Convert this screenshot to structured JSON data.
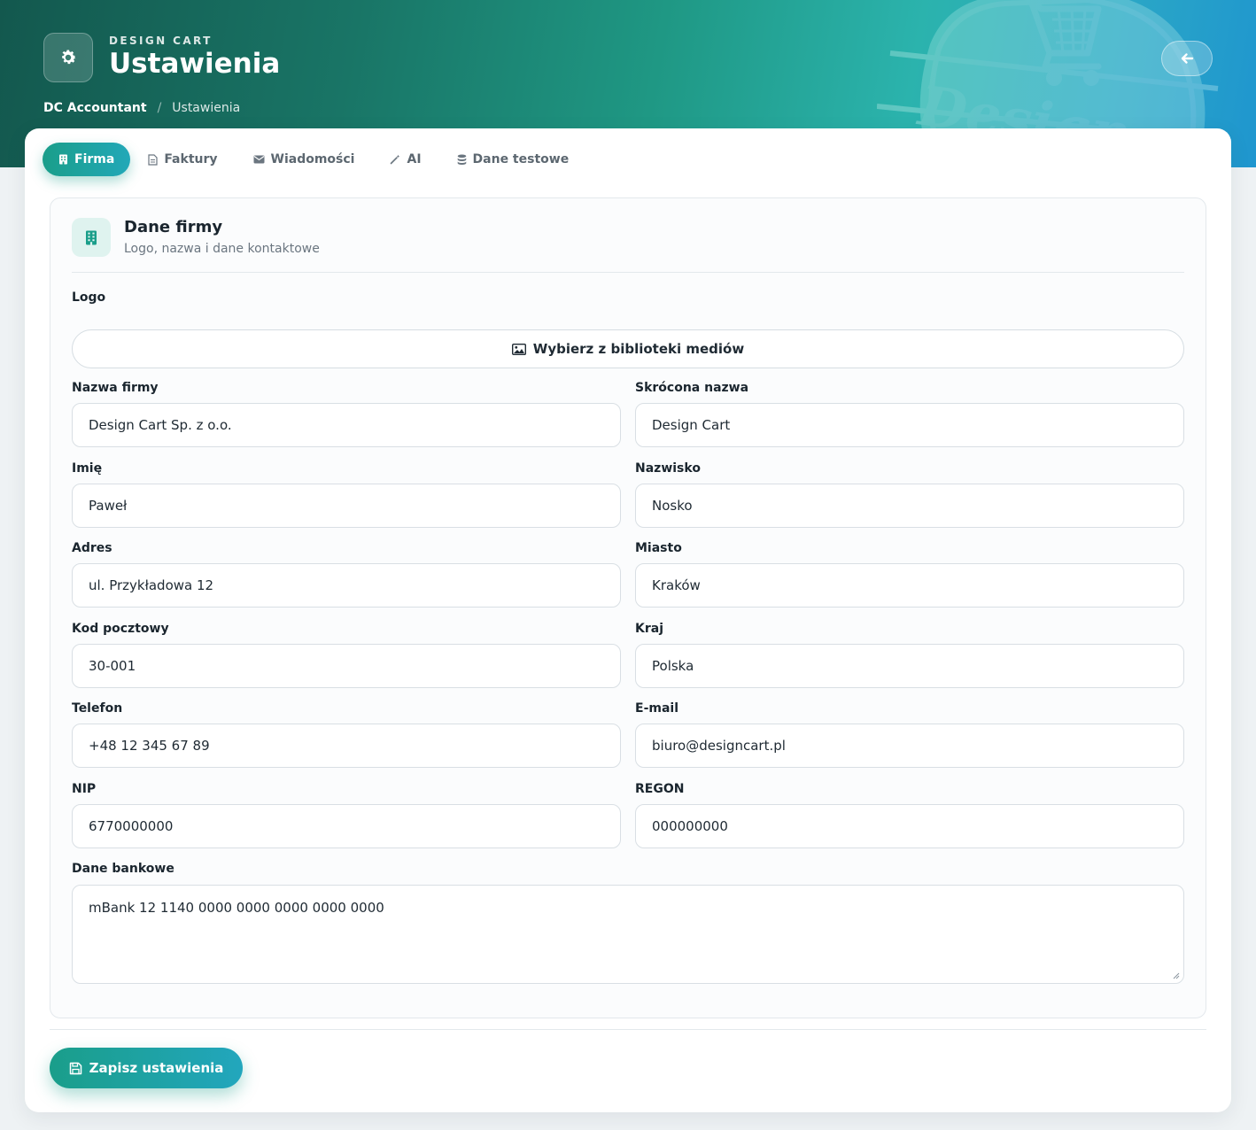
{
  "header": {
    "kicker": "DESIGN CART",
    "title": "Ustawienia",
    "watermark_text": "Design"
  },
  "breadcrumb": {
    "root": "DC Accountant",
    "separator": "/",
    "current": "Ustawienia"
  },
  "tabs": [
    {
      "label": "Firma",
      "icon": "building-icon",
      "active": true
    },
    {
      "label": "Faktury",
      "icon": "document-icon",
      "active": false
    },
    {
      "label": "Wiadomości",
      "icon": "envelope-icon",
      "active": false
    },
    {
      "label": "AI",
      "icon": "magic-wand-icon",
      "active": false
    },
    {
      "label": "Dane testowe",
      "icon": "database-icon",
      "active": false
    }
  ],
  "section": {
    "title": "Dane firmy",
    "subtitle": "Logo, nazwa i dane kontaktowe",
    "logo_label": "Logo",
    "media_button": "Wybierz z biblioteki mediów"
  },
  "fields": {
    "company_name": {
      "label": "Nazwa firmy",
      "value": "Design Cart Sp. z o.o."
    },
    "short_name": {
      "label": "Skrócona nazwa",
      "value": "Design Cart"
    },
    "first_name": {
      "label": "Imię",
      "value": "Paweł"
    },
    "last_name": {
      "label": "Nazwisko",
      "value": "Nosko"
    },
    "address": {
      "label": "Adres",
      "value": "ul. Przykładowa 12"
    },
    "city": {
      "label": "Miasto",
      "value": "Kraków"
    },
    "postal_code": {
      "label": "Kod pocztowy",
      "value": "30-001"
    },
    "country": {
      "label": "Kraj",
      "value": "Polska"
    },
    "phone": {
      "label": "Telefon",
      "value": "+48 12 345 67 89"
    },
    "email": {
      "label": "E-mail",
      "value": "biuro@designcart.pl"
    },
    "nip": {
      "label": "NIP",
      "value": "6770000000"
    },
    "regon": {
      "label": "REGON",
      "value": "000000000"
    },
    "bank": {
      "label": "Dane bankowe",
      "value": "mBank 12 1140 0000 0000 0000 0000 0000"
    }
  },
  "actions": {
    "save_label": "Zapisz ustawienia"
  },
  "colors": {
    "accent": "#1a9e8a",
    "accent_2": "#22a8b8",
    "hero_start": "#13584e",
    "hero_end": "#1f96cf"
  }
}
